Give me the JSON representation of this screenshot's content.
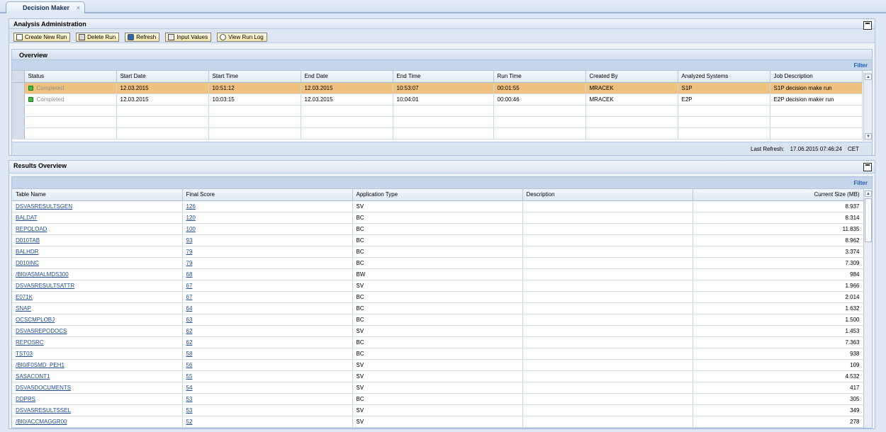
{
  "tab": {
    "label": "Decision Maker",
    "close": "×"
  },
  "admin": {
    "title": "Analysis Administration",
    "toolbar": {
      "create": "Create New Run",
      "delete": "Delete Run",
      "refresh": "Refresh",
      "input": "Input Values",
      "log": "View Run Log"
    },
    "overview": {
      "title": "Overview",
      "filter": "Filter",
      "columns": [
        "Status",
        "Start Date",
        "Start Time",
        "End Date",
        "End Time",
        "Run Time",
        "Created By",
        "Analyzed Systems",
        "Job Description"
      ],
      "rows": [
        {
          "status": "Completed",
          "start_date": "12.03.2015",
          "start_time": "10:51:12",
          "end_date": "12.03.2015",
          "end_time": "10:53:07",
          "run_time": "00:01:55",
          "created_by": "MRACEK",
          "systems": "S1P",
          "job": "S1P decision make run"
        },
        {
          "status": "Completed",
          "start_date": "12.03.2015",
          "start_time": "10:03:15",
          "end_date": "12.03.2015",
          "end_time": "10:04:01",
          "run_time": "00:00:46",
          "created_by": "MRACEK",
          "systems": "E2P",
          "job": "E2P decision maker run"
        }
      ],
      "last_refresh_label": "Last Refresh:",
      "last_refresh_value": "17.06.2015 07:46:24",
      "last_refresh_tz": "CET"
    }
  },
  "results": {
    "title": "Results Overview",
    "filter": "Filter",
    "columns": [
      "Table Name",
      "Final Score",
      "Application Type",
      "Description",
      "Current Size (MB)"
    ],
    "rows": [
      {
        "name": "DSVASRESULTSGEN",
        "score": "126",
        "type": "SV",
        "desc": "",
        "size": "8.937"
      },
      {
        "name": "BALDAT",
        "score": "120",
        "type": "BC",
        "desc": "",
        "size": "8.314"
      },
      {
        "name": "REPOLOAD",
        "score": "100",
        "type": "BC",
        "desc": "",
        "size": "11.835"
      },
      {
        "name": "D010TAB",
        "score": "93",
        "type": "BC",
        "desc": "",
        "size": "8.962"
      },
      {
        "name": "BALHDR",
        "score": "79",
        "type": "BC",
        "desc": "",
        "size": "3.374"
      },
      {
        "name": "D010INC",
        "score": "79",
        "type": "BC",
        "desc": "",
        "size": "7.309"
      },
      {
        "name": "/BI0/ASMALMDS300",
        "score": "68",
        "type": "BW",
        "desc": "",
        "size": "984"
      },
      {
        "name": "DSVASRESULTSATTR",
        "score": "67",
        "type": "SV",
        "desc": "",
        "size": "1.966"
      },
      {
        "name": "E071K",
        "score": "67",
        "type": "BC",
        "desc": "",
        "size": "2.014"
      },
      {
        "name": "SNAP",
        "score": "64",
        "type": "BC",
        "desc": "",
        "size": "1.632"
      },
      {
        "name": "OCSCMPLOBJ",
        "score": "63",
        "type": "BC",
        "desc": "",
        "size": "1.500"
      },
      {
        "name": "DSVASREPODOCS",
        "score": "62",
        "type": "SV",
        "desc": "",
        "size": "1.453"
      },
      {
        "name": "REPOSRC",
        "score": "62",
        "type": "BC",
        "desc": "",
        "size": "7.363"
      },
      {
        "name": "TST03",
        "score": "58",
        "type": "BC",
        "desc": "",
        "size": "938"
      },
      {
        "name": "/BI0/F0SMD_PEH1",
        "score": "56",
        "type": "SV",
        "desc": "",
        "size": "109"
      },
      {
        "name": "SASACONT1",
        "score": "55",
        "type": "SV",
        "desc": "",
        "size": "4.532"
      },
      {
        "name": "DSVASDOCUMENTS",
        "score": "54",
        "type": "SV",
        "desc": "",
        "size": "417"
      },
      {
        "name": "DDPRS",
        "score": "53",
        "type": "BC",
        "desc": "",
        "size": "305"
      },
      {
        "name": "DSVASRESULTSSEL",
        "score": "53",
        "type": "SV",
        "desc": "",
        "size": "349"
      },
      {
        "name": "/BI0/ACCMAGGR00",
        "score": "52",
        "type": "SV",
        "desc": "",
        "size": "278"
      }
    ]
  }
}
